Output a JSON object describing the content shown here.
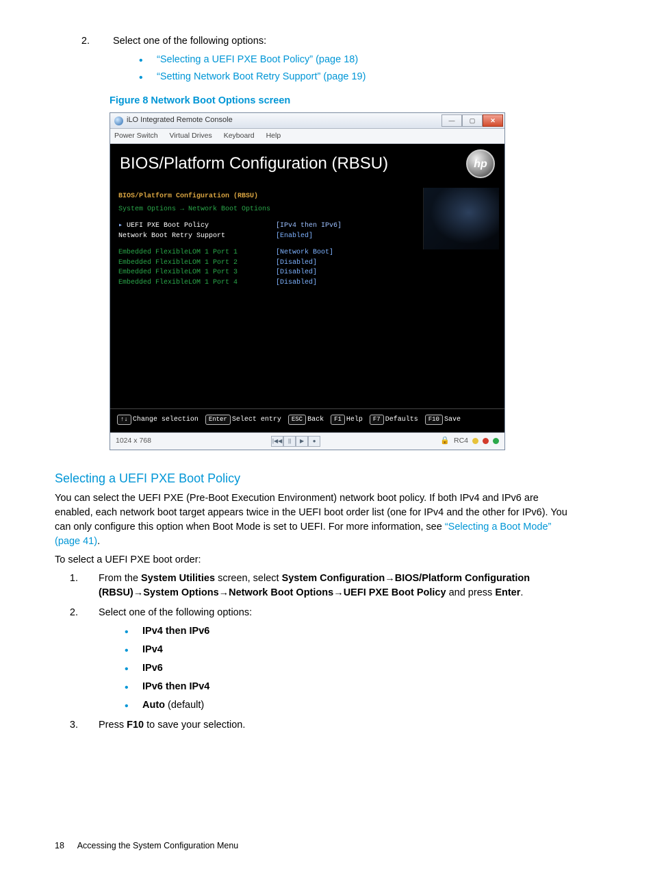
{
  "step2_intro": "Select one of the following options:",
  "step2_links": [
    "“Selecting a UEFI PXE Boot Policy” (page 18)",
    "“Setting Network Boot Retry Support” (page 19)"
  ],
  "figure_caption": "Figure 8 Network Boot Options screen",
  "screenshot": {
    "window_title": "iLO Integrated Remote Console",
    "menubar": [
      "Power Switch",
      "Virtual Drives",
      "Keyboard",
      "Help"
    ],
    "bios_title": "BIOS/Platform Configuration (RBSU)",
    "logo_text": "hp",
    "crumb1": "BIOS/Platform Configuration (RBSU)",
    "crumb2": "System Options → Network Boot Options",
    "rows_main": [
      {
        "label": "UEFI PXE Boot Policy",
        "value": "[IPv4 then IPv6]",
        "selected": true
      },
      {
        "label": "Network Boot Retry Support",
        "value": "[Enabled]",
        "selected": false
      }
    ],
    "rows_ports": [
      {
        "label": "Embedded FlexibleLOM 1 Port 1",
        "value": "[Network Boot]"
      },
      {
        "label": "Embedded FlexibleLOM 1 Port 2",
        "value": "[Disabled]"
      },
      {
        "label": "Embedded FlexibleLOM 1 Port 3",
        "value": "[Disabled]"
      },
      {
        "label": "Embedded FlexibleLOM 1 Port 4",
        "value": "[Disabled]"
      }
    ],
    "footer_keys": [
      {
        "key": "↑↓",
        "label": "Change selection"
      },
      {
        "key": "Enter",
        "label": "Select entry"
      },
      {
        "key": "ESC",
        "label": "Back"
      },
      {
        "key": "F1",
        "label": "Help"
      },
      {
        "key": "F7",
        "label": "Defaults"
      },
      {
        "key": "F10",
        "label": "Save"
      }
    ],
    "status_left": "1024 x 768",
    "status_mid_btns": [
      "|◀◀",
      "||",
      "▶",
      "●"
    ],
    "status_right_label": "RC4"
  },
  "section_heading": "Selecting a UEFI PXE Boot Policy",
  "para1_pre": "You can select the UEFI PXE (Pre-Boot Execution Environment) network boot policy. If both IPv4 and IPv6 are enabled, each network boot target appears twice in the UEFI boot order list (one for IPv4 and the other for IPv6). You can only configure this option when Boot Mode is set to UEFI. For more information, see ",
  "para1_link": "“Selecting a Boot Mode” (page 41)",
  "para1_post": ".",
  "para2": "To select a UEFI PXE boot order:",
  "step_nav": {
    "pre": "From the ",
    "b1": "System Utilities",
    "mid1": " screen, select ",
    "b2": "System Configuration",
    "arrow": "→",
    "b3": "BIOS/Platform Configuration (RBSU)",
    "b4": "System Options",
    "b5": "Network Boot Options",
    "b6": "UEFI PXE Boot Policy",
    "mid2": " and press ",
    "b7": "Enter",
    "post": "."
  },
  "step2b_intro": "Select one of the following options:",
  "options": [
    {
      "bold": "IPv4 then IPv6",
      "extra": ""
    },
    {
      "bold": "IPv4",
      "extra": ""
    },
    {
      "bold": "IPv6",
      "extra": ""
    },
    {
      "bold": "IPv6 then IPv4",
      "extra": ""
    },
    {
      "bold": "Auto",
      "extra": " (default)"
    }
  ],
  "step3_pre": "Press ",
  "step3_key": "F10",
  "step3_post": " to save your selection.",
  "footer": {
    "page": "18",
    "title": "Accessing the System Configuration Menu"
  }
}
